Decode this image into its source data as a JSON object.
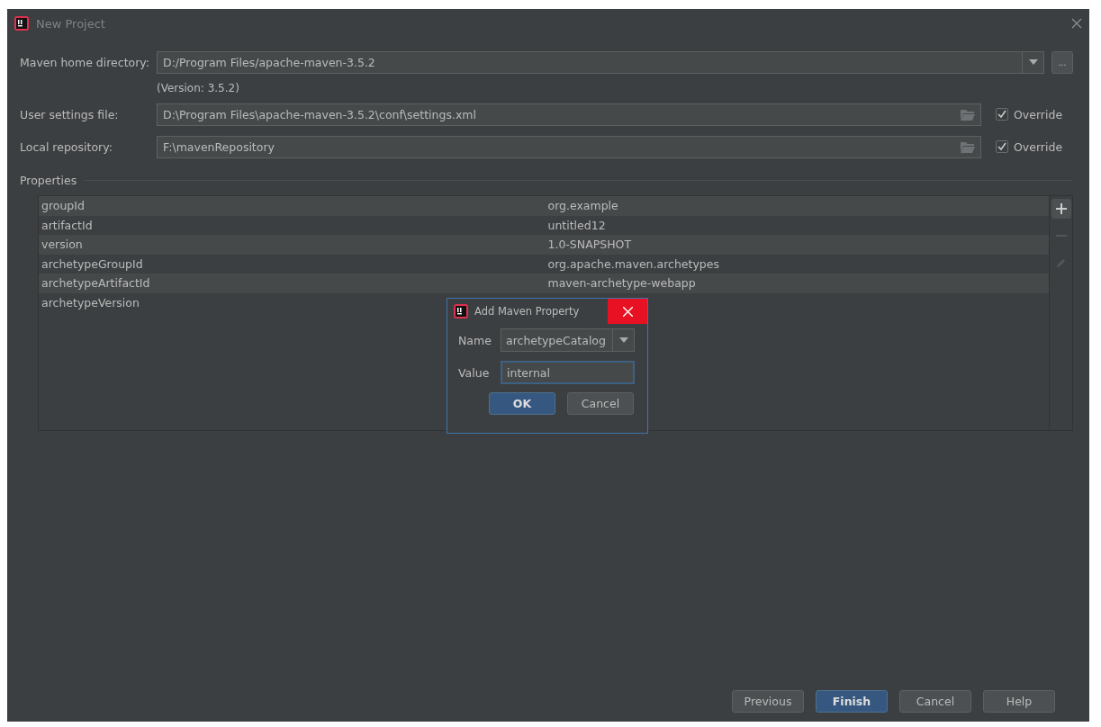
{
  "window": {
    "title": "New Project"
  },
  "fields": [
    {
      "label": "Maven home directory:",
      "value": "D:/Program Files/apache-maven-3.5.2",
      "kind": "combo",
      "browse": "...",
      "note": "(Version: 3.5.2)"
    },
    {
      "label": "User settings file:",
      "value": "D:\\Program Files\\apache-maven-3.5.2\\conf\\settings.xml",
      "kind": "path",
      "override": {
        "label": "Override",
        "checked": true
      }
    },
    {
      "label": "Local repository:",
      "value": "F:\\mavenRepository",
      "kind": "path",
      "override": {
        "label": "Override",
        "checked": true
      }
    }
  ],
  "properties": {
    "title": "Properties",
    "rows": [
      {
        "name": "groupId",
        "value": "org.example"
      },
      {
        "name": "artifactId",
        "value": "untitled12"
      },
      {
        "name": "version",
        "value": "1.0-SNAPSHOT"
      },
      {
        "name": "archetypeGroupId",
        "value": "org.apache.maven.archetypes"
      },
      {
        "name": "archetypeArtifactId",
        "value": "maven-archetype-webapp"
      },
      {
        "name": "archetypeVersion"
      }
    ]
  },
  "dialog": {
    "title": "Add Maven Property",
    "name_label": "Name",
    "name_value": "archetypeCatalog",
    "value_label": "Value",
    "value_value": "internal",
    "buttons": [
      {
        "label": "OK",
        "default": true
      },
      {
        "label": "Cancel",
        "default": false
      }
    ]
  },
  "buttons": [
    {
      "label": "Previous",
      "default": false
    },
    {
      "label": "Finish",
      "default": true
    },
    {
      "label": "Cancel",
      "default": false
    },
    {
      "label": "Help",
      "default": false
    }
  ]
}
